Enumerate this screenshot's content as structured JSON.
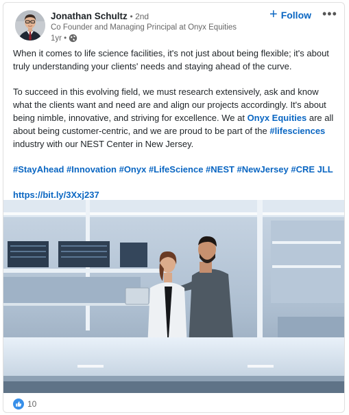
{
  "author": {
    "name": "Jonathan Schultz",
    "degree": "• 2nd",
    "headline": "Co Founder and Managing Principal at Onyx Equities",
    "time": "1yr •",
    "visibility_icon": "globe-icon"
  },
  "actions": {
    "follow_label": "Follow",
    "follow_icon": "plus-icon",
    "more_icon": "more-horizontal-icon"
  },
  "post": {
    "p1": "When it comes to life science facilities, it's not just about being flexible; it's about truly understanding your clients' needs and staying ahead of the curve.",
    "p2_a": "To succeed in this evolving field, we must research extensively, ask and know what the clients want and need are and align our projects accordingly. It's about being nimble, innovative, and striving for excellence. We at ",
    "p2_link": "Onyx Equities",
    "p2_b": " are all about being customer-centric, and we are proud to be part of the ",
    "p2_hashtag": "#lifesciences",
    "p2_c": " industry with our NEST Center in New Jersey.",
    "hashtags": "#StayAhead #Innovation #Onyx #LifeScience #NEST #NewJersey #CRE JLL",
    "url": "https://bit.ly/3Xxj237"
  },
  "reactions": {
    "count": "10",
    "icon": "thumbs-up-icon"
  },
  "colors": {
    "accent": "#0a66c2",
    "reaction": "#378fe9"
  }
}
